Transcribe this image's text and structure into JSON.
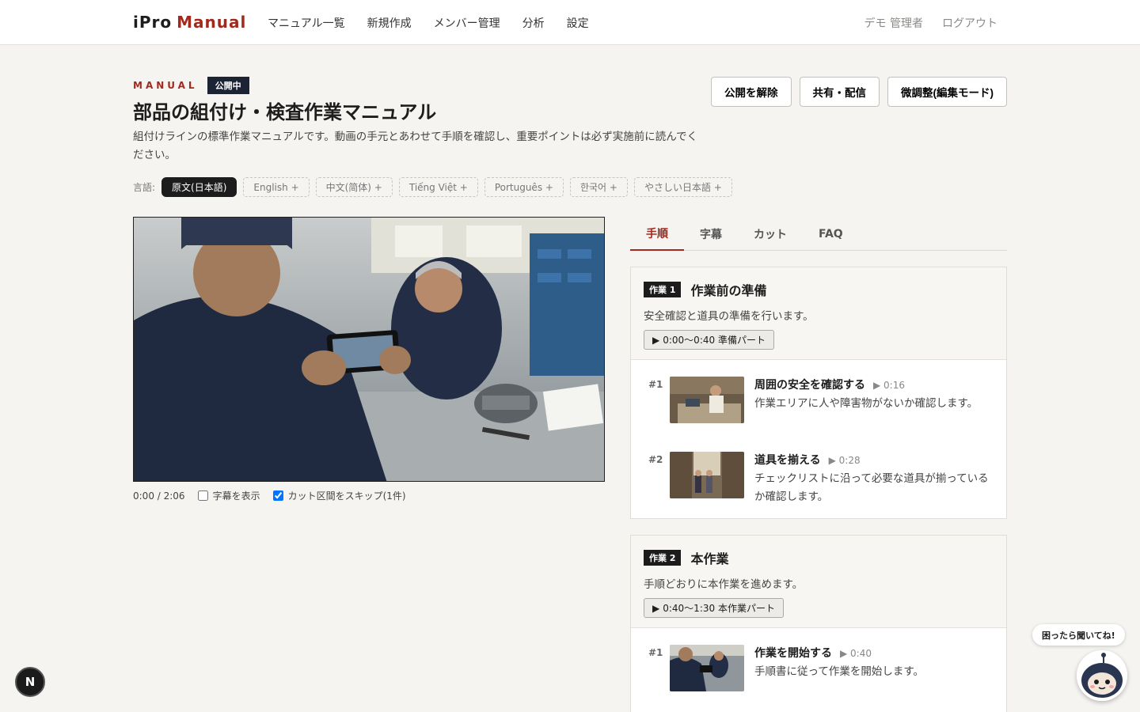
{
  "header": {
    "logo_part1": "iPro",
    "logo_part2": "Manual",
    "nav": [
      "マニュアル一覧",
      "新規作成",
      "メンバー管理",
      "分析",
      "設定"
    ],
    "user": "デモ 管理者",
    "logout": "ログアウト"
  },
  "page": {
    "eyebrow": "MANUAL",
    "status": "公開中",
    "title": "部品の組付け・検査作業マニュアル",
    "description": "組付けラインの標準作業マニュアルです。動画の手元とあわせて手順を確認し、重要ポイントは必ず実施前に読んでください。"
  },
  "actions": [
    "公開を解除",
    "共有・配信",
    "微調整(編集モード)"
  ],
  "languages": {
    "label": "言語:",
    "items": [
      "原文(日本語)",
      "English +",
      "中文(简体) +",
      "Tiếng Việt +",
      "Português +",
      "한국어 +",
      "やさしい日本語 +"
    ]
  },
  "video": {
    "time": "0:00 / 2:06",
    "show_subtitles": "字幕を表示",
    "skip_cuts": "カット区間をスキップ(1件)"
  },
  "tabs": [
    "手順",
    "字幕",
    "カット",
    "FAQ"
  ],
  "sections": [
    {
      "badge": "作業 1",
      "name": "作業前の準備",
      "desc": "安全確認と道具の準備を行います。",
      "part": "0:00〜0:40 準備パート",
      "items": [
        {
          "num": "#1",
          "title": "周囲の安全を確認する",
          "time": "0:16",
          "desc": "作業エリアに人や障害物がないか確認します。"
        },
        {
          "num": "#2",
          "title": "道具を揃える",
          "time": "0:28",
          "desc": "チェックリストに沿って必要な道具が揃っているか確認します。"
        }
      ]
    },
    {
      "badge": "作業 2",
      "name": "本作業",
      "desc": "手順どおりに本作業を進めます。",
      "part": "0:40〜1:30 本作業パート",
      "items": [
        {
          "num": "#1",
          "title": "作業を開始する",
          "time": "0:40",
          "desc": "手順書に従って作業を開始します。"
        }
      ]
    }
  ],
  "floating": {
    "n_badge": "N",
    "help": "困ったら聞いてね!"
  },
  "colors": {
    "accent": "#a3291d",
    "dark": "#1c2433",
    "background": "#f5f4f1"
  }
}
